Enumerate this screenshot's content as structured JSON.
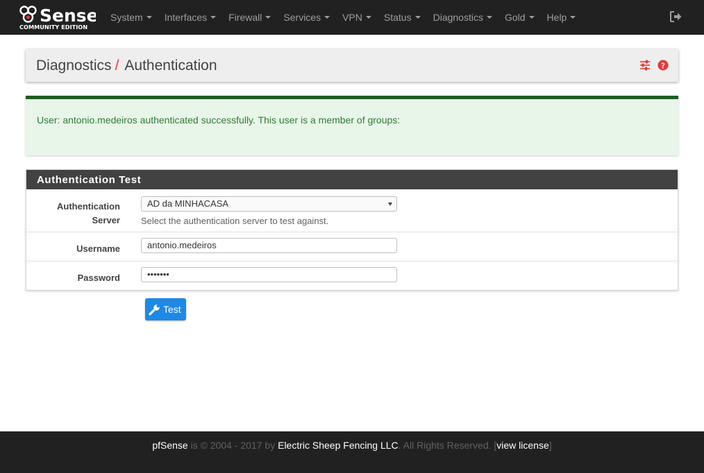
{
  "navbar": {
    "logo_text": "Sense",
    "logo_subtext": "COMMUNITY EDITION",
    "menu": [
      {
        "label": "System"
      },
      {
        "label": "Interfaces"
      },
      {
        "label": "Firewall"
      },
      {
        "label": "Services"
      },
      {
        "label": "VPN"
      },
      {
        "label": "Status"
      },
      {
        "label": "Diagnostics"
      },
      {
        "label": "Gold"
      },
      {
        "label": "Help"
      }
    ],
    "logout_icon": "sign-out-icon"
  },
  "breadcrumb": {
    "parent": "Diagnostics",
    "separator": "/",
    "current": "Authentication",
    "icons": [
      "sliders-icon",
      "question-circle-icon"
    ]
  },
  "alert": {
    "message": "User: antonio.medeiros authenticated successfully. This user is a member of groups:"
  },
  "auth_panel": {
    "title": "Authentication Test",
    "server": {
      "label_line1": "Authentication",
      "label_line2": "Server",
      "value": "AD da MINHACASA",
      "help": "Select the authentication server to test against."
    },
    "username": {
      "label": "Username",
      "value": "antonio.medeiros"
    },
    "password": {
      "label": "Password",
      "value": "•••••••"
    }
  },
  "test_button": {
    "label": "Test",
    "icon": "wrench-icon"
  },
  "footer": {
    "brand": "pfSense",
    "copyright": " is © 2004 - 2017 by ",
    "company": "Electric Sheep Fencing LLC",
    "rights": ". All Rights Reserved. [",
    "license": "view license",
    "close_bracket": "]"
  },
  "colors": {
    "navbar_bg": "#212121",
    "accent_red": "#e53935",
    "success_bg": "#e8f5e9",
    "success_border": "#1b5e20",
    "button_blue": "#1e88e5",
    "panel_heading": "#424242"
  }
}
